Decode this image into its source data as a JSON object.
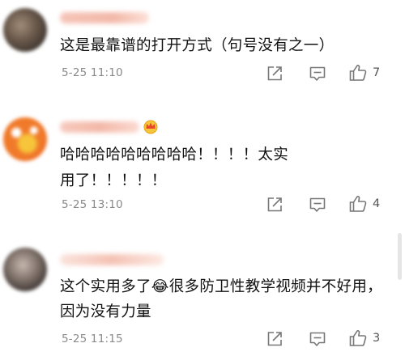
{
  "comments": [
    {
      "text": "这是最靠谱的打开方式（句号没有之一）",
      "time": "5-25 11:10",
      "likes": "7",
      "avatar_colors": [
        "#6b5a4c",
        "#3a322c",
        "#a08c78"
      ]
    },
    {
      "text": "哈哈哈哈哈哈哈哈哈！！！！太实用了！！！！！",
      "time": "5-25 13:10",
      "likes": "4",
      "avatar_colors": [
        "#f06a22",
        "#f7c53a",
        "#ffffff"
      ]
    },
    {
      "text": "这个实用多了😂很多防卫性教学视频并不好用，因为没有力量",
      "time": "5-25 11:15",
      "likes": "3",
      "avatar_colors": [
        "#7a6d66",
        "#2e2725",
        "#c7b8ae"
      ]
    }
  ],
  "icons": {
    "share": "share-icon",
    "reply": "comment-icon",
    "like": "thumbs-up-icon"
  },
  "colors": {
    "timestamp": "#8a8a8a",
    "icon_stroke": "#777777",
    "username_blur": "#f2b8a8"
  }
}
